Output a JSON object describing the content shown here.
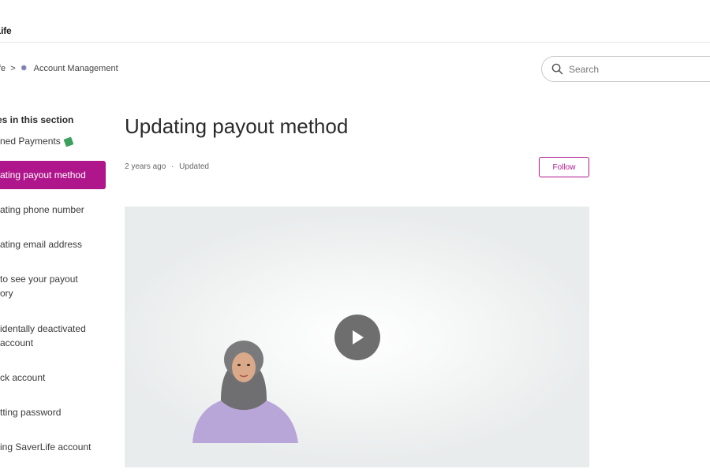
{
  "brand": {
    "logo_text": "Life"
  },
  "breadcrumb": {
    "parent": "fe",
    "separator": ">",
    "current": "Account Management"
  },
  "search": {
    "placeholder": "Search"
  },
  "sidebar": {
    "heading": "es in this section",
    "items": [
      {
        "line1": "rned Payments",
        "line2": ""
      },
      {
        "line1": "ating payout method",
        "line2": ""
      },
      {
        "line1": "ating phone number",
        "line2": ""
      },
      {
        "line1": "ating email address",
        "line2": ""
      },
      {
        "line1": " to see your payout",
        "line2": "ory"
      },
      {
        "line1": "identally deactivated",
        "line2": "account"
      },
      {
        "line1": "ck account",
        "line2": ""
      },
      {
        "line1": "tting password",
        "line2": ""
      },
      {
        "line1": "ing SaverLife account",
        "line2": ""
      }
    ]
  },
  "article": {
    "title": "Updating payout method",
    "age": "2 years ago",
    "dot": "·",
    "status": "Updated",
    "follow_label": "Follow"
  },
  "colors": {
    "accent": "#b0168c",
    "play": "#6e6e6e",
    "sweater": "#b9a6d8",
    "hijab": "#7a7a7a"
  },
  "icons": [
    "logo-mark-icon",
    "gear-icon",
    "search-icon",
    "money-icon",
    "play-icon"
  ]
}
